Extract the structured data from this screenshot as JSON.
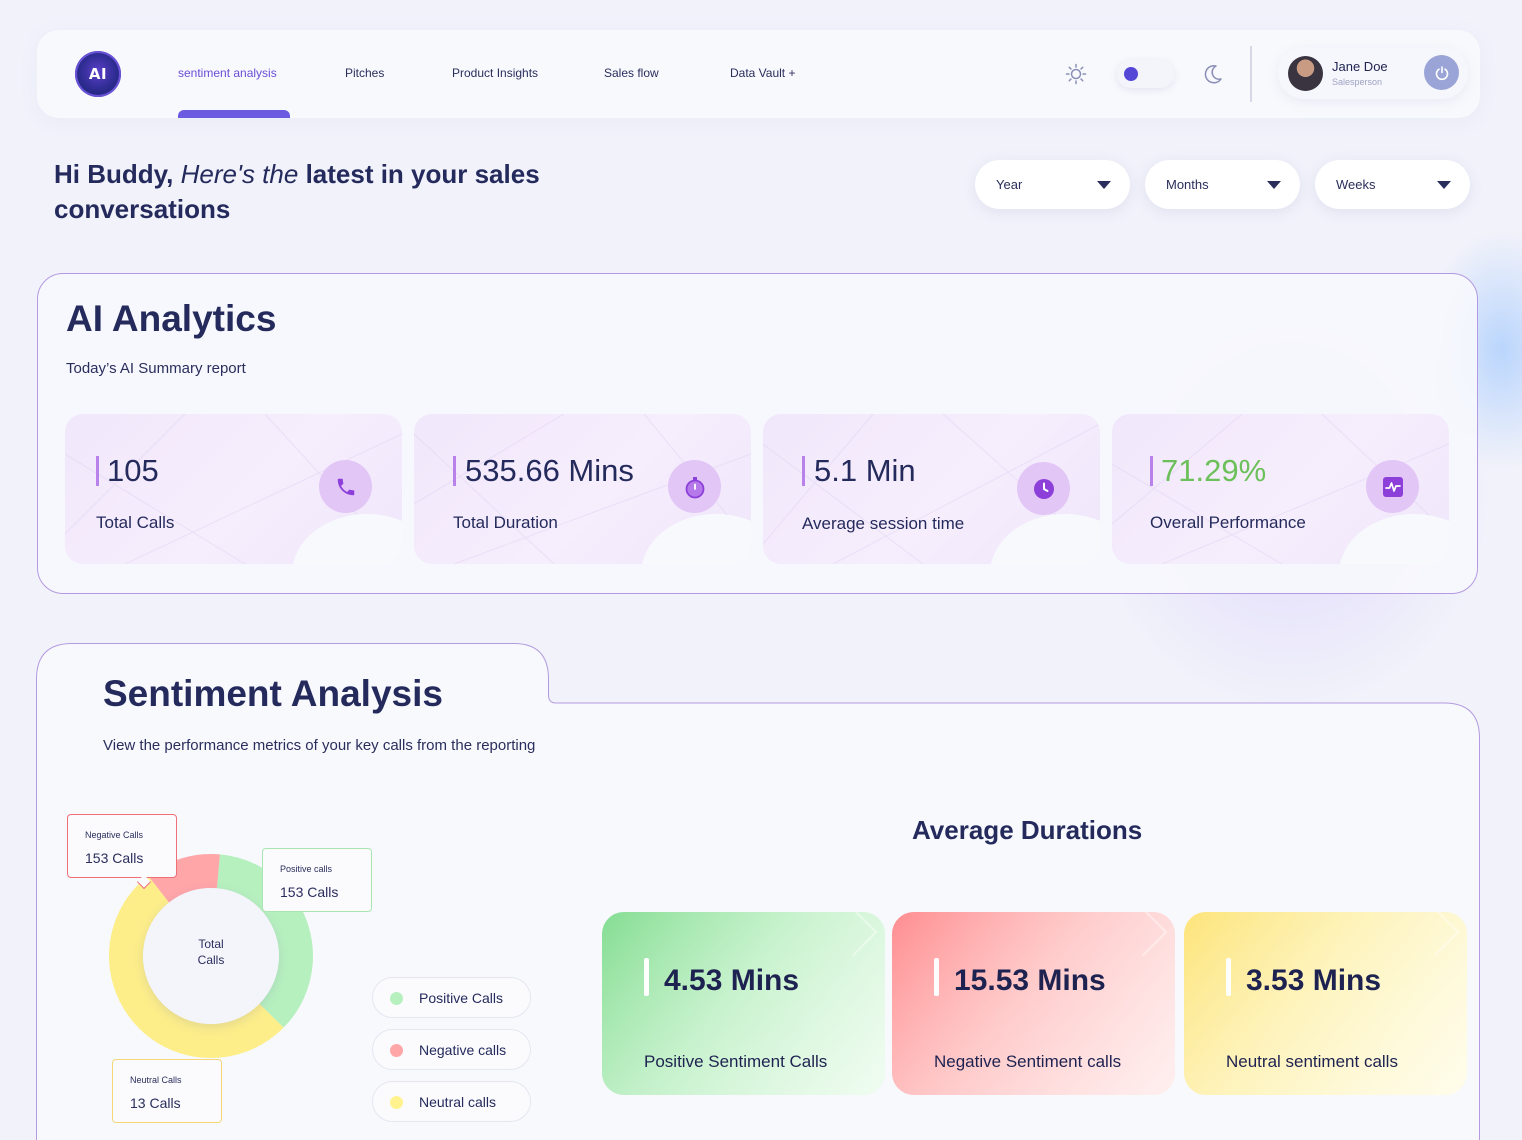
{
  "nav": {
    "logo_text": "AI",
    "items": [
      {
        "label": "sentiment analysis",
        "active": true
      },
      {
        "label": "Pitches"
      },
      {
        "label": "Product Insights"
      },
      {
        "label": "Sales flow"
      },
      {
        "label": "Data Vault +"
      }
    ],
    "icons": {
      "theme_light": "sun-icon",
      "theme_dark": "moon-icon",
      "power": "power-icon"
    },
    "profile": {
      "name": "Jane Doe",
      "role": "Salesperson"
    }
  },
  "greeting": {
    "part1": "Hi Buddy,",
    "part2": "Here's the",
    "part3": "latest in your sales conversations"
  },
  "filters": [
    {
      "label": "Year"
    },
    {
      "label": "Months"
    },
    {
      "label": "Weeks"
    }
  ],
  "ai_analytics": {
    "title": "AI Analytics",
    "subtitle": "Today’s AI Summary report",
    "cards": [
      {
        "value": "105",
        "label": "Total Calls",
        "icon": "phone-icon"
      },
      {
        "value": "535.66 Mins",
        "label": "Total Duration",
        "icon": "stopwatch-icon"
      },
      {
        "value": "5.1 Min",
        "label": "Average session time",
        "icon": "clock-icon"
      },
      {
        "value": "71.29%",
        "label": "Overall Performance",
        "icon": "activity-icon"
      }
    ]
  },
  "sentiment": {
    "title": "Sentiment Analysis",
    "subtitle": "View the performance metrics of your key calls from the reporting",
    "donut": {
      "center_label_1": "Total",
      "center_label_2": "Calls",
      "segments": [
        {
          "name": "Positive calls",
          "fraction": 0.36,
          "color": "#b7f0bf"
        },
        {
          "name": "Neutral calls",
          "fraction": 0.52,
          "color": "#fdee8a"
        },
        {
          "name": "Negative calls",
          "fraction": 0.12,
          "color": "#ffa6a8"
        }
      ]
    },
    "callouts": {
      "negative": {
        "title": "Negative Calls",
        "value": "153 Calls"
      },
      "positive": {
        "title": "Positive calls",
        "value": "153 Calls"
      },
      "neutral": {
        "title": "Neutral Calls",
        "value": "13 Calls"
      }
    },
    "legend": [
      {
        "label": "Positive Calls",
        "color": "#b7f0bf"
      },
      {
        "label": "Negative calls",
        "color": "#ffa6a8"
      },
      {
        "label": "Neutral calls",
        "color": "#fff28f"
      }
    ],
    "average": {
      "title": "Average Durations",
      "cards": [
        {
          "value": "4.53 Mins",
          "label": "Positive Sentiment Calls",
          "color": "#8fe39a"
        },
        {
          "value": "15.53 Mins",
          "label": "Negative Sentiment calls",
          "color": "#ff9b9d"
        },
        {
          "value": "3.53 Mins",
          "label": "Neutral sentiment calls",
          "color": "#fde98a"
        }
      ]
    }
  }
}
